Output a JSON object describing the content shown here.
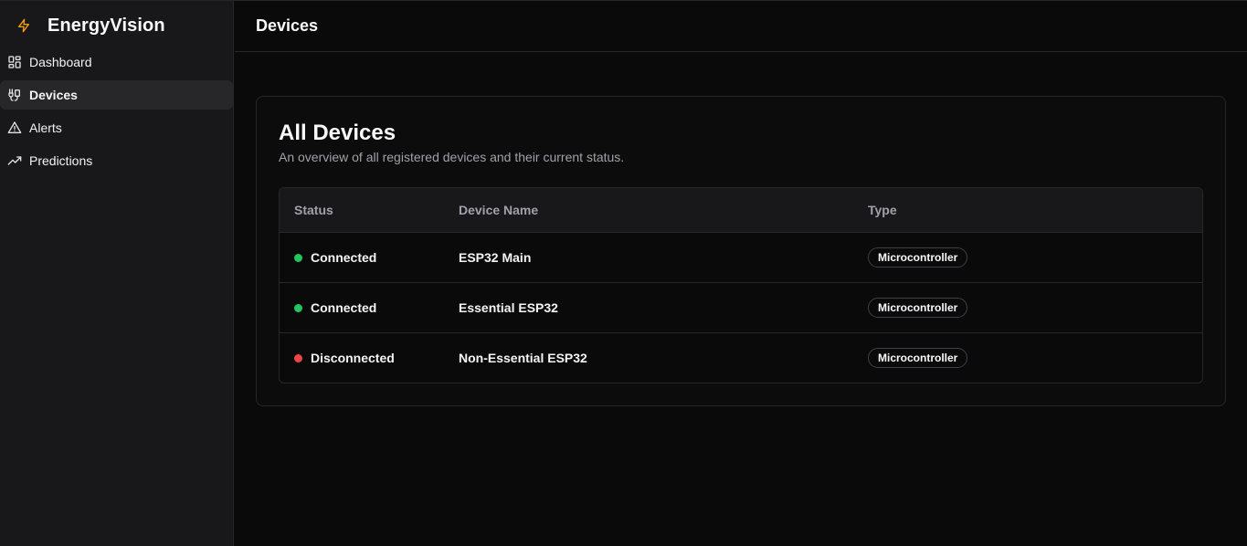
{
  "app": {
    "name": "EnergyVision",
    "brand_color": "#f59e0b"
  },
  "sidebar": {
    "items": [
      {
        "label": "Dashboard",
        "icon": "dashboard-icon",
        "active": false
      },
      {
        "label": "Devices",
        "icon": "devices-icon",
        "active": true
      },
      {
        "label": "Alerts",
        "icon": "alert-triangle-icon",
        "active": false
      },
      {
        "label": "Predictions",
        "icon": "trending-up-icon",
        "active": false
      }
    ]
  },
  "header": {
    "title": "Devices"
  },
  "card": {
    "title": "All Devices",
    "description": "An overview of all registered devices and their current status."
  },
  "table": {
    "columns": [
      "Status",
      "Device Name",
      "Type"
    ],
    "rows": [
      {
        "status": "Connected",
        "status_color": "#22c55e",
        "device": "ESP32 Main",
        "type": "Microcontroller"
      },
      {
        "status": "Connected",
        "status_color": "#22c55e",
        "device": "Essential ESP32",
        "type": "Microcontroller"
      },
      {
        "status": "Disconnected",
        "status_color": "#ef4444",
        "device": "Non-Essential ESP32",
        "type": "Microcontroller"
      }
    ]
  }
}
